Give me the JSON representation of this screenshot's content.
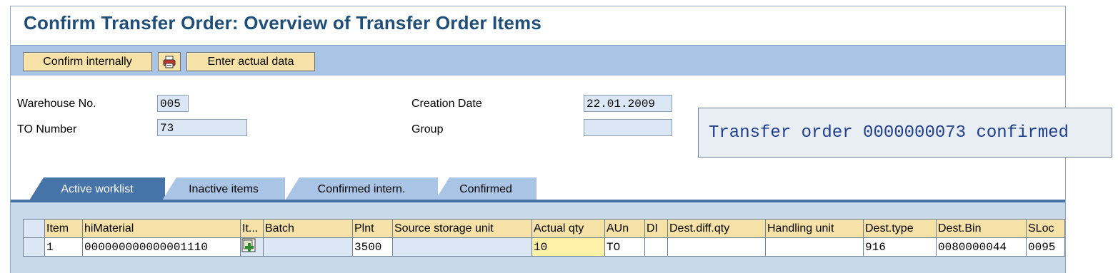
{
  "title": "Confirm Transfer Order: Overview of Transfer Order Items",
  "toolbar": {
    "confirm_internally": "Confirm internally",
    "enter_actual_data": "Enter actual data",
    "print_icon": "printer-icon"
  },
  "header": {
    "warehouse_label": "Warehouse No.",
    "warehouse_value": "005",
    "to_number_label": "TO Number",
    "to_number_value": "73",
    "creation_date_label": "Creation Date",
    "creation_date_value": "22.01.2009",
    "group_label": "Group",
    "group_value": ""
  },
  "message": "Transfer order 0000000073 confirmed",
  "tabs": [
    "Active worklist",
    "Inactive items",
    "Confirmed intern.",
    "Confirmed"
  ],
  "table": {
    "columns": [
      "Item",
      "hiMaterial",
      "It...",
      "Batch",
      "Plnt",
      "Source storage unit",
      "Actual qty",
      "AUn",
      "DI",
      "Dest.diff.qty",
      "Handling unit",
      "Dest.type",
      "Dest.Bin",
      "SLoc"
    ],
    "rows": [
      {
        "item": "1",
        "material": "000000000000001110",
        "batch": "",
        "plnt": "3500",
        "source_storage_unit": "",
        "actual_qty": "10",
        "aun": "TO",
        "di": "",
        "dest_diff_qty": "",
        "handling_unit": "",
        "dest_type": "916",
        "dest_bin": "0080000044",
        "sloc": "0095"
      }
    ]
  },
  "colors": {
    "title": "#1f4e79",
    "toolbar": "#a9c4e4",
    "button": "#f6e1a6",
    "active_tab": "#4774a8"
  }
}
